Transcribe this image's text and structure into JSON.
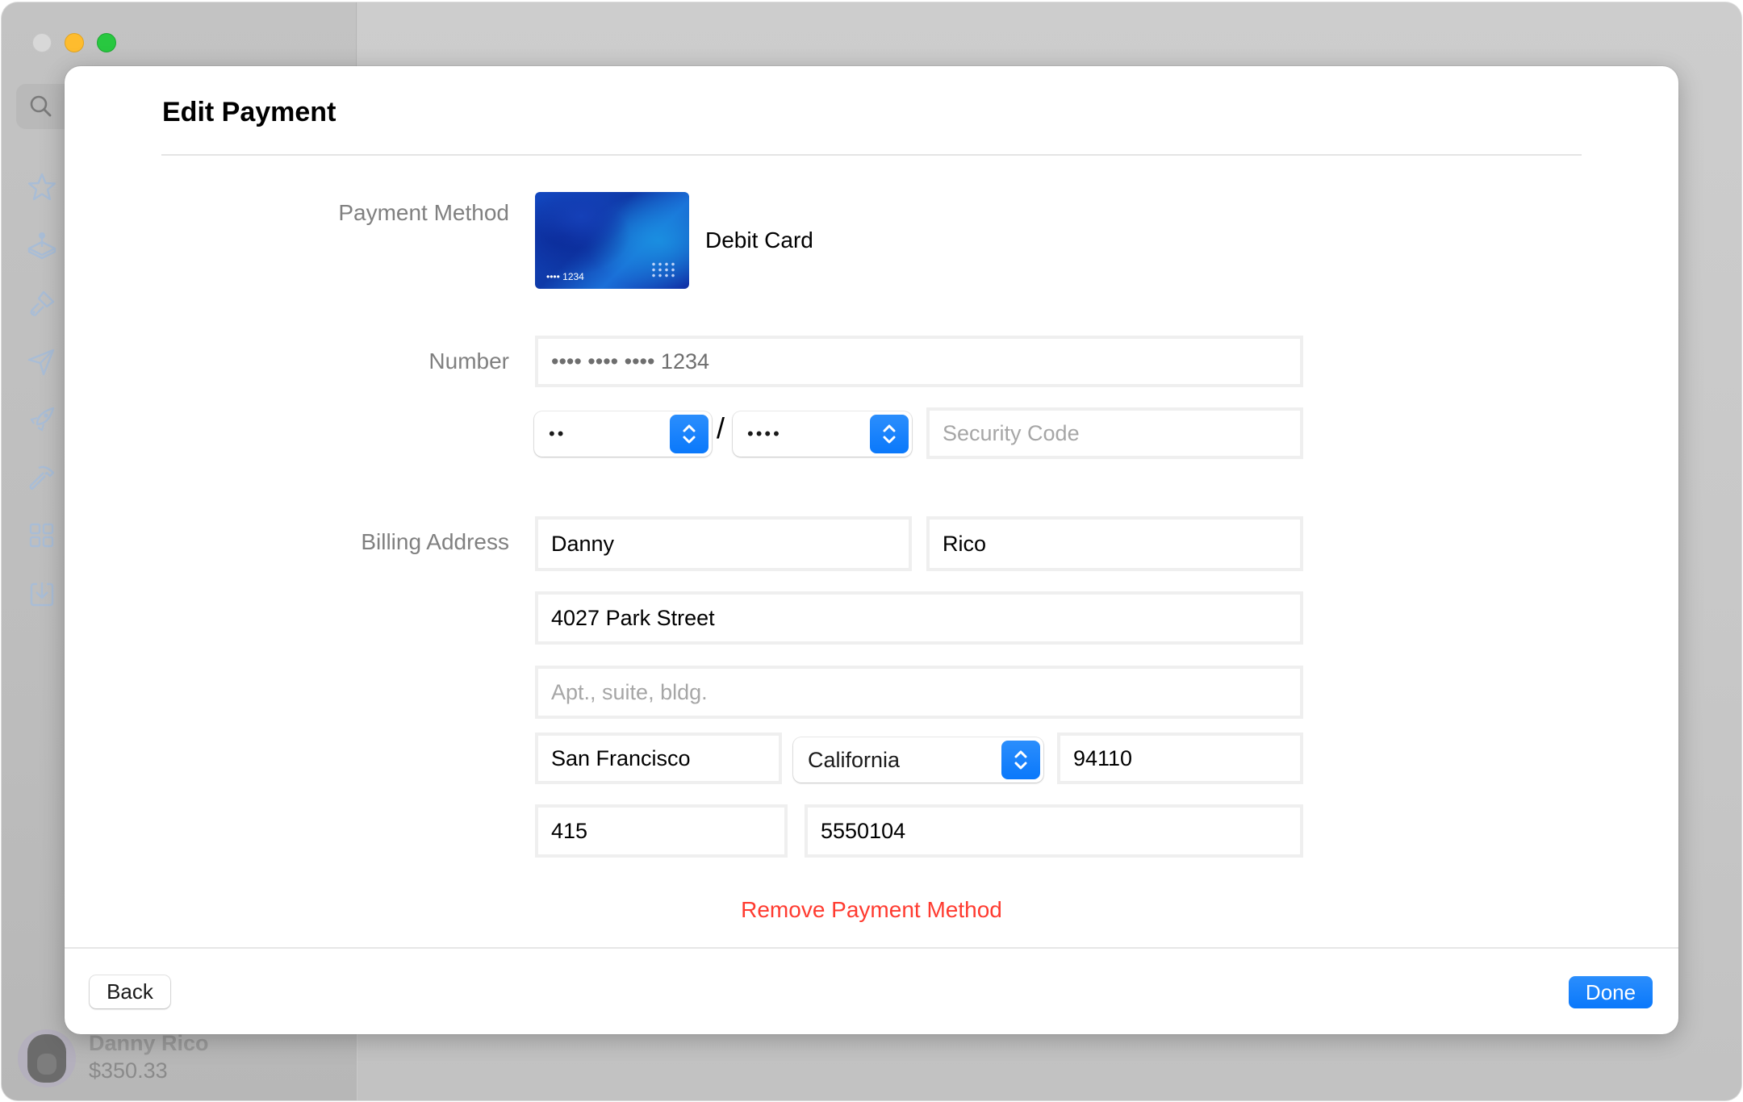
{
  "window": {
    "traffic_lights": [
      "close",
      "minimize",
      "zoom"
    ]
  },
  "sidebar": {
    "search_icon": "search-icon",
    "items": [
      {
        "icon": "star-icon"
      },
      {
        "icon": "joystick-icon"
      },
      {
        "icon": "paintbrush-icon"
      },
      {
        "icon": "paperplane-icon"
      },
      {
        "icon": "rocket-icon"
      },
      {
        "icon": "hammer-icon"
      },
      {
        "icon": "grid-icon"
      },
      {
        "icon": "download-icon"
      }
    ],
    "user": {
      "name": "Danny Rico",
      "balance": "$350.33"
    }
  },
  "modal": {
    "title": "Edit Payment",
    "payment_method": {
      "label": "Payment Method",
      "card_last_digits": "•••• 1234",
      "card_type": "Debit Card"
    },
    "number": {
      "label": "Number",
      "value": "•••• •••• •••• 1234",
      "expiry_month": "••",
      "separator": "/",
      "expiry_year": "••••",
      "security_code_placeholder": "Security Code"
    },
    "billing": {
      "label": "Billing Address",
      "first_name": "Danny",
      "last_name": "Rico",
      "street": "4027 Park Street",
      "apt_placeholder": "Apt., suite, bldg.",
      "city": "San Francisco",
      "state": "California",
      "zip": "94110",
      "area_code": "415",
      "phone": "5550104"
    },
    "remove_label": "Remove Payment Method",
    "back_label": "Back",
    "done_label": "Done"
  },
  "colors": {
    "accent": "#0a78fb",
    "destructive": "#ff3b30",
    "sidebar_icon": "#a9bdd6"
  }
}
